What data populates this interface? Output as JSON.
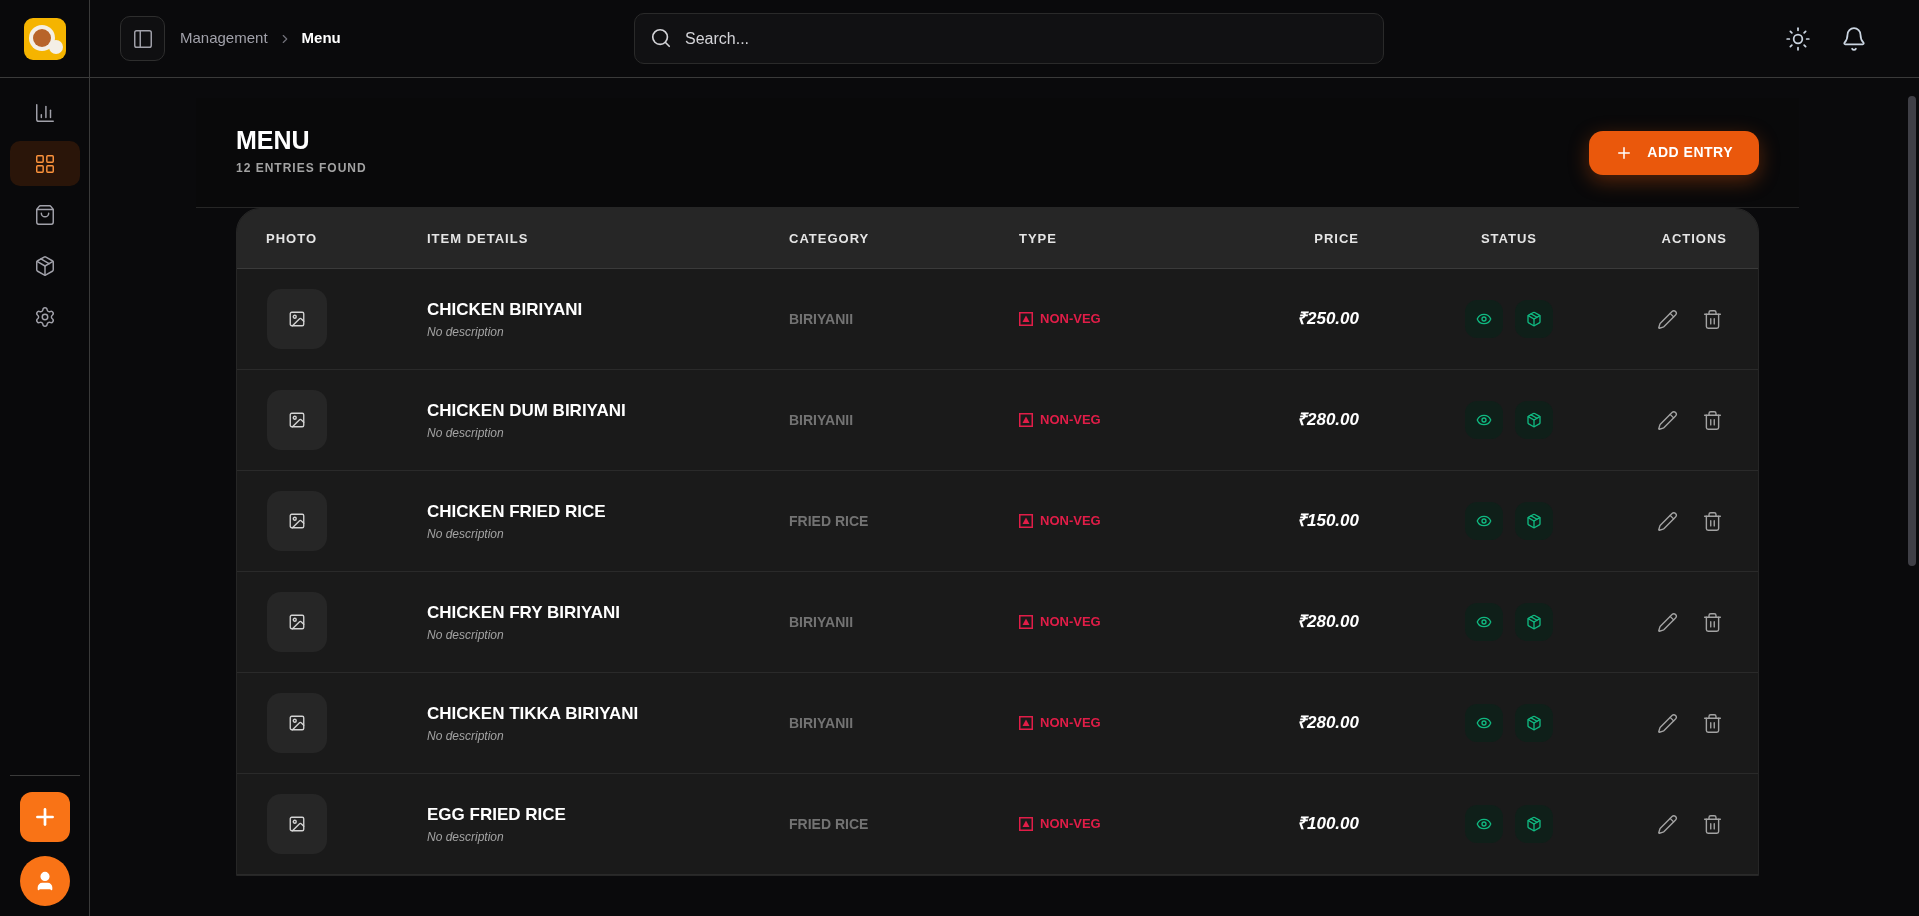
{
  "breadcrumb": [
    {
      "label": "Management",
      "current": false
    },
    {
      "label": "Menu",
      "current": true
    }
  ],
  "search": {
    "placeholder": "Search..."
  },
  "sidebar": {
    "items": [
      {
        "kind": "chart",
        "selected": false
      },
      {
        "kind": "grid",
        "selected": true
      },
      {
        "kind": "bag",
        "selected": false
      },
      {
        "kind": "box",
        "selected": false
      },
      {
        "kind": "settings",
        "selected": false
      }
    ]
  },
  "page": {
    "title": "MENU",
    "subtitle": "12 ENTRIES FOUND",
    "add_button": "ADD ENTRY"
  },
  "table": {
    "columns": [
      "PHOTO",
      "ITEM DETAILS",
      "CATEGORY",
      "TYPE",
      "PRICE",
      "STATUS",
      "ACTIONS"
    ],
    "rows": [
      {
        "name": "CHICKEN BIRIYANI",
        "description": "No description",
        "category": "BIRIYANII",
        "type": "NON-VEG",
        "price": "₹250.00",
        "visible": true,
        "in_stock": true
      },
      {
        "name": "CHICKEN DUM BIRIYANI",
        "description": "No description",
        "category": "BIRIYANII",
        "type": "NON-VEG",
        "price": "₹280.00",
        "visible": true,
        "in_stock": true
      },
      {
        "name": "CHICKEN FRIED RICE",
        "description": "No description",
        "category": "FRIED RICE",
        "type": "NON-VEG",
        "price": "₹150.00",
        "visible": true,
        "in_stock": true
      },
      {
        "name": "CHICKEN FRY BIRIYANI",
        "description": "No description",
        "category": "BIRIYANII",
        "type": "NON-VEG",
        "price": "₹280.00",
        "visible": true,
        "in_stock": true
      },
      {
        "name": "CHICKEN TIKKA BIRIYANI",
        "description": "No description",
        "category": "BIRIYANII",
        "type": "NON-VEG",
        "price": "₹280.00",
        "visible": true,
        "in_stock": true
      },
      {
        "name": "EGG FRIED RICE",
        "description": "No description",
        "category": "FRIED RICE",
        "type": "NON-VEG",
        "price": "₹100.00",
        "visible": true,
        "in_stock": true
      }
    ]
  }
}
